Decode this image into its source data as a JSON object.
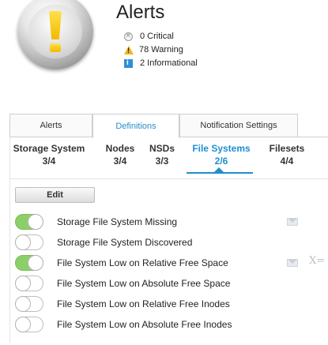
{
  "header": {
    "title": "Alerts",
    "summary": [
      {
        "icon": "critical-icon",
        "text": "0 Critical"
      },
      {
        "icon": "warning-icon",
        "text": "78 Warning"
      },
      {
        "icon": "info-icon",
        "text": "2 Informational"
      }
    ]
  },
  "tabs": [
    {
      "label": "Alerts",
      "active": false
    },
    {
      "label": "Definitions",
      "active": true
    },
    {
      "label": "Notification Settings",
      "active": false
    }
  ],
  "subtabs": [
    {
      "label": "Storage System",
      "count": "3/4",
      "active": false
    },
    {
      "label": "Nodes",
      "count": "3/4",
      "active": false
    },
    {
      "label": "NSDs",
      "count": "3/3",
      "active": false
    },
    {
      "label": "File Systems",
      "count": "2/6",
      "active": true
    },
    {
      "label": "Filesets",
      "count": "4/4",
      "active": false
    }
  ],
  "edit_label": "Edit",
  "definitions": [
    {
      "label": "Storage File System Missing",
      "enabled": true,
      "email": true,
      "sms": false
    },
    {
      "label": "Storage File System Discovered",
      "enabled": false,
      "email": false,
      "sms": false
    },
    {
      "label": "File System Low on Relative Free Space",
      "enabled": true,
      "email": true,
      "sms": true
    },
    {
      "label": "File System Low on Absolute Free Space",
      "enabled": false,
      "email": false,
      "sms": false
    },
    {
      "label": "File System Low on Relative Free Inodes",
      "enabled": false,
      "email": false,
      "sms": false
    },
    {
      "label": "File System Low on Absolute Free Inodes",
      "enabled": false,
      "email": false,
      "sms": false
    }
  ],
  "sms_glyph": "X="
}
